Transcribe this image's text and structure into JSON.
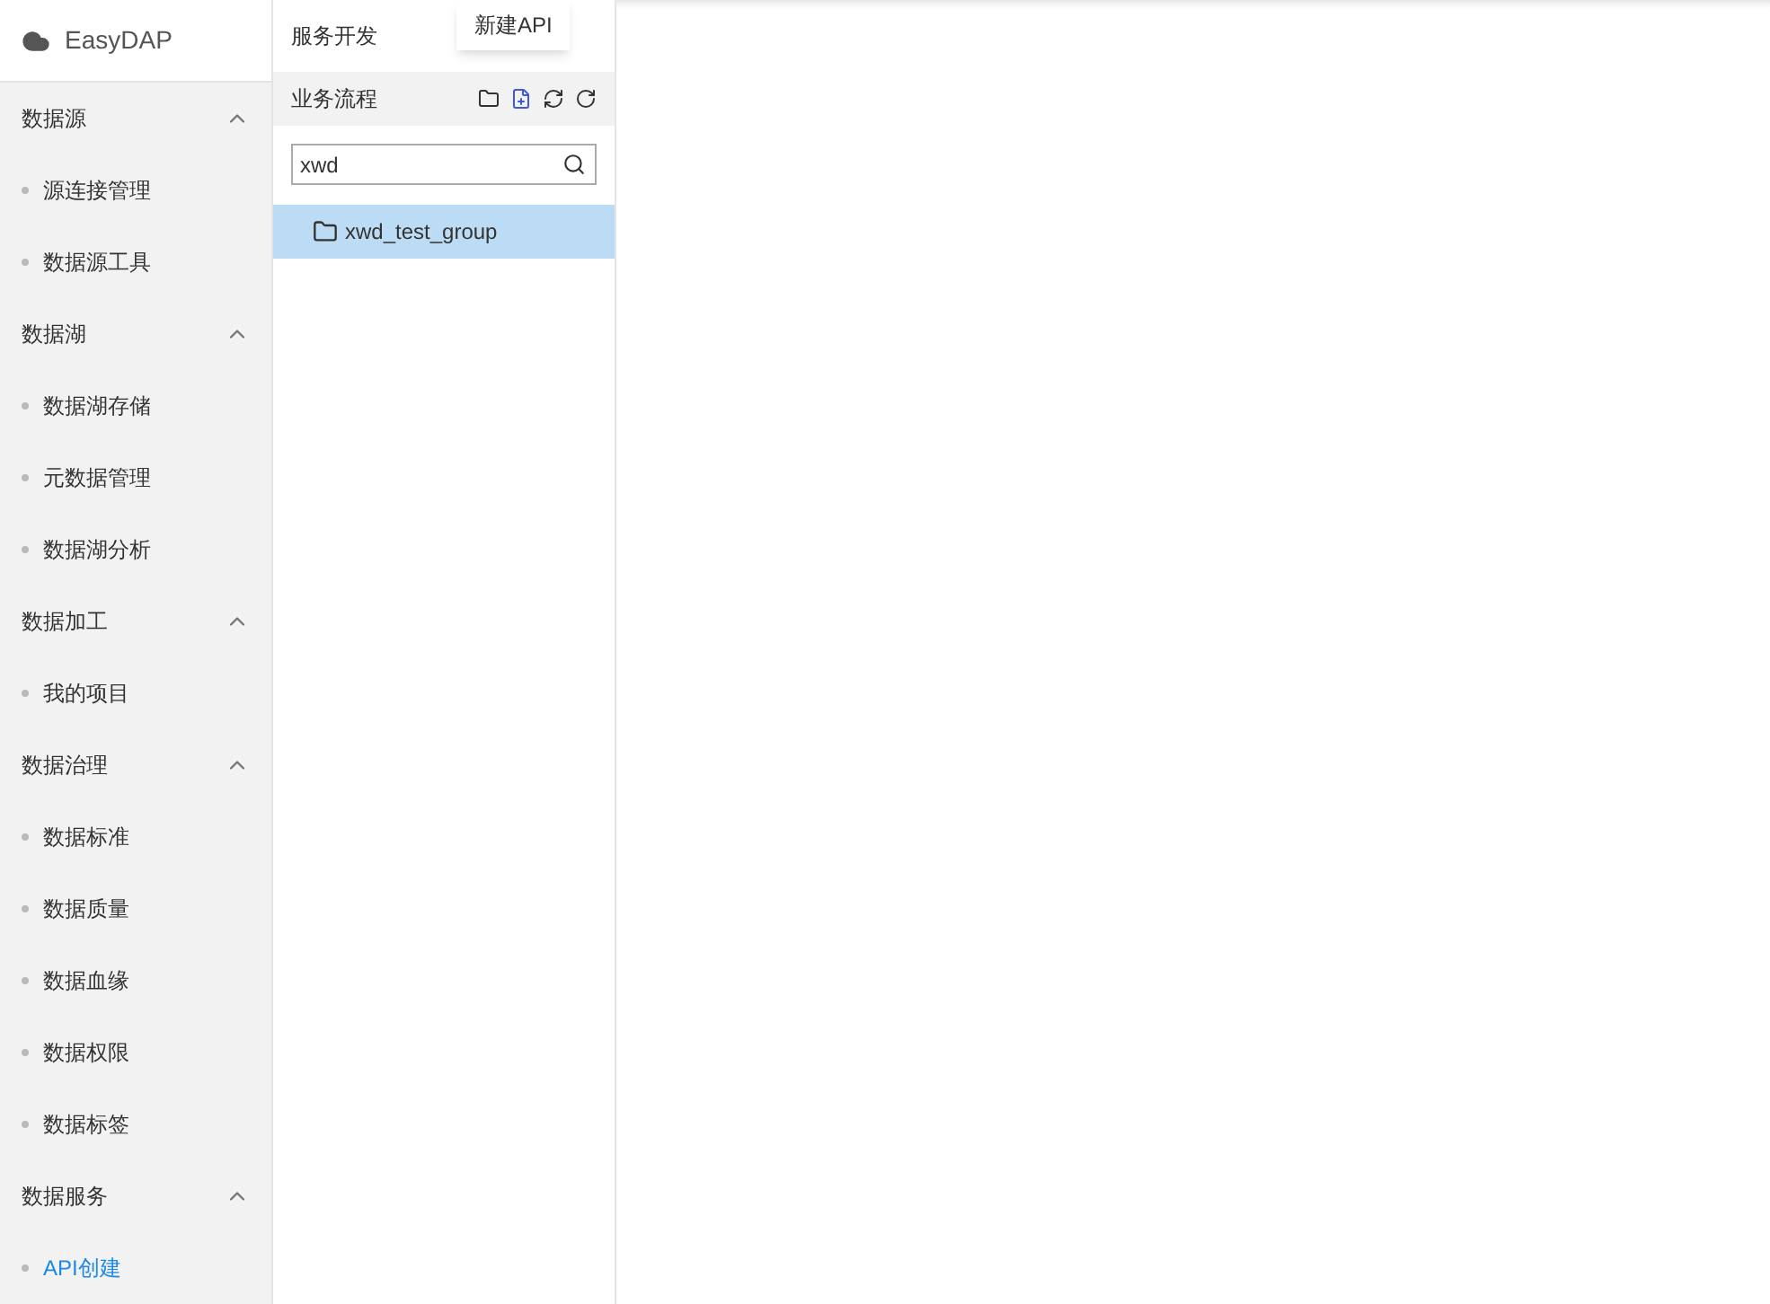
{
  "app": {
    "name": "EasyDAP"
  },
  "sidebar": {
    "groups": [
      {
        "label": "数据源",
        "expanded": true,
        "items": [
          {
            "label": "源连接管理",
            "selected": false
          },
          {
            "label": "数据源工具",
            "selected": false
          }
        ]
      },
      {
        "label": "数据湖",
        "expanded": true,
        "items": [
          {
            "label": "数据湖存储",
            "selected": false
          },
          {
            "label": "元数据管理",
            "selected": false
          },
          {
            "label": "数据湖分析",
            "selected": false
          }
        ]
      },
      {
        "label": "数据加工",
        "expanded": true,
        "items": [
          {
            "label": "我的项目",
            "selected": false
          }
        ]
      },
      {
        "label": "数据治理",
        "expanded": true,
        "items": [
          {
            "label": "数据标准",
            "selected": false
          },
          {
            "label": "数据质量",
            "selected": false
          },
          {
            "label": "数据血缘",
            "selected": false
          },
          {
            "label": "数据权限",
            "selected": false
          },
          {
            "label": "数据标签",
            "selected": false
          }
        ]
      },
      {
        "label": "数据服务",
        "expanded": true,
        "items": [
          {
            "label": "API创建",
            "selected": true
          }
        ]
      }
    ]
  },
  "panel": {
    "title": "服务开发",
    "section": "业务流程",
    "tooltip": "新建API",
    "search": {
      "value": "xwd"
    },
    "tree": [
      {
        "label": "xwd_test_group",
        "selected": true
      }
    ]
  }
}
